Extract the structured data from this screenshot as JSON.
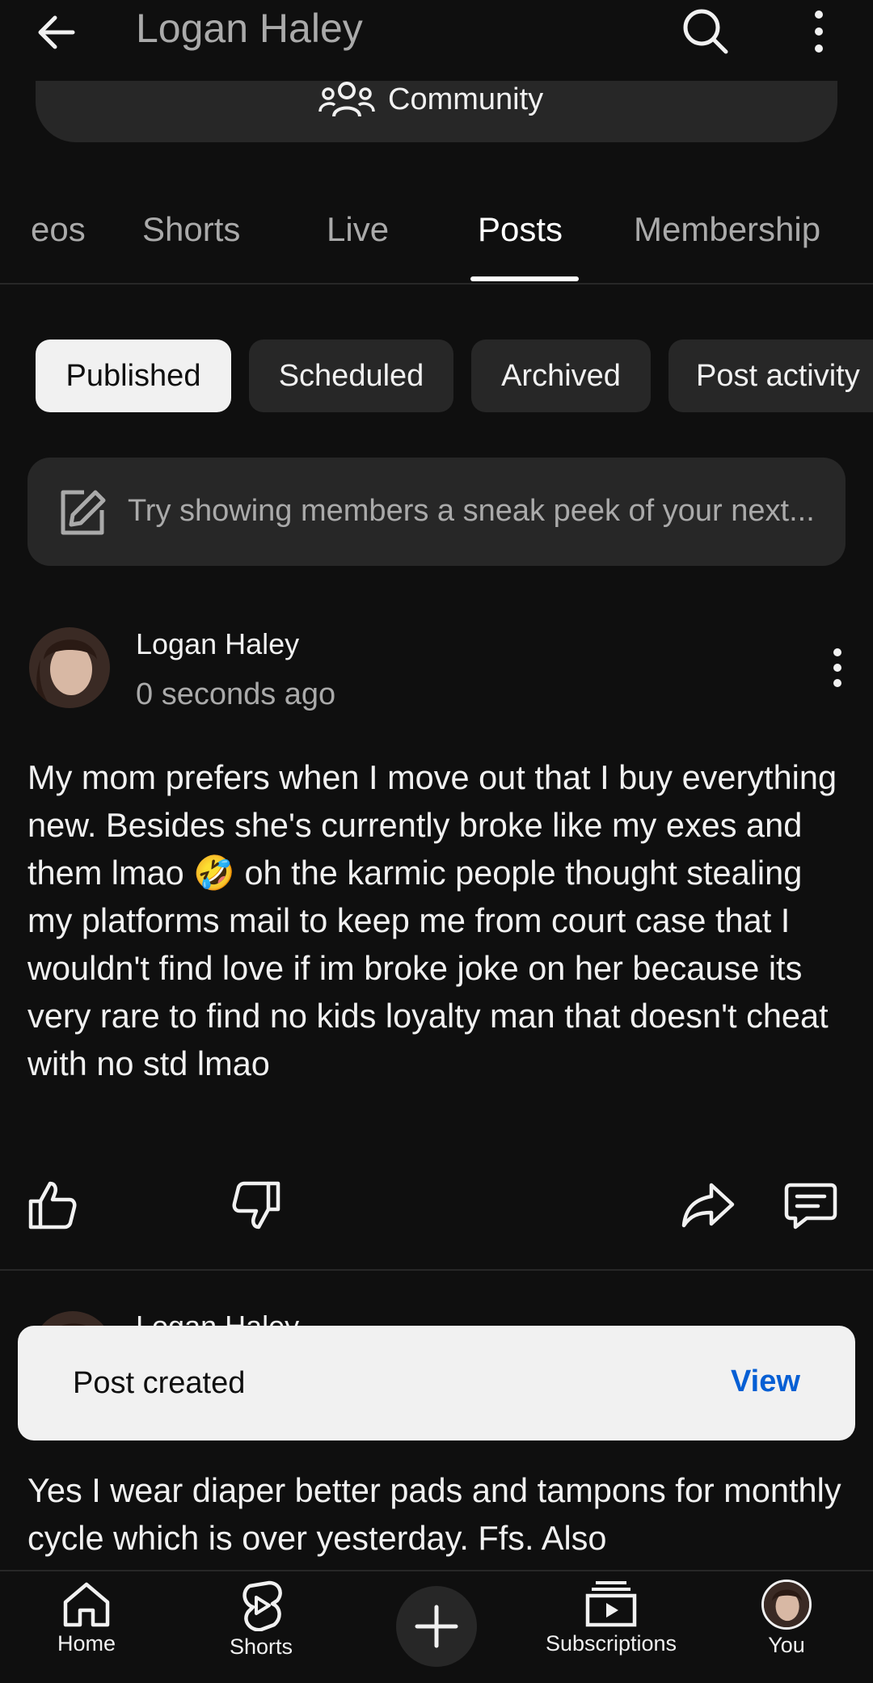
{
  "header": {
    "title": "Logan Haley"
  },
  "community": {
    "label": "Community"
  },
  "tabs": [
    {
      "label": "eos"
    },
    {
      "label": "Shorts"
    },
    {
      "label": "Live"
    },
    {
      "label": "Posts"
    },
    {
      "label": "Membership"
    }
  ],
  "active_tab": "Posts",
  "chips": [
    {
      "label": "Published",
      "selected": true
    },
    {
      "label": "Scheduled",
      "selected": false
    },
    {
      "label": "Archived",
      "selected": false
    },
    {
      "label": "Post activity",
      "selected": false
    }
  ],
  "composer": {
    "placeholder": "Try showing members a sneak peek of your next..."
  },
  "post": {
    "author": "Logan Haley",
    "time": "0 seconds ago",
    "body": "My mom prefers when I move out that I buy everything new. Besides she's currently broke like my exes and them lmao 🤣 oh the karmic people thought stealing my platforms mail to keep me from court case that I wouldn't find love if im broke joke on her because its very rare to find no kids loyalty man that doesn't cheat with no std lmao"
  },
  "next_post": {
    "author": "Logan Haley",
    "body": "Yes I wear diaper better pads and tampons for monthly cycle which is over yesterday.  Ffs. Also"
  },
  "snackbar": {
    "message": "Post created",
    "action": "View"
  },
  "nav": {
    "home": "Home",
    "shorts": "Shorts",
    "subscriptions": "Subscriptions",
    "you": "You"
  },
  "colors": {
    "background": "#0f0f0f",
    "surface": "#272727",
    "text": "#f1f1f1",
    "secondary": "#aaaaaa",
    "link": "#065fd4"
  },
  "icons": [
    "back-arrow-icon",
    "search-icon",
    "more-vert-icon",
    "community-icon",
    "edit-icon",
    "like-icon",
    "dislike-icon",
    "share-icon",
    "comment-icon",
    "home-icon",
    "shorts-icon",
    "plus-icon",
    "subscriptions-icon"
  ]
}
